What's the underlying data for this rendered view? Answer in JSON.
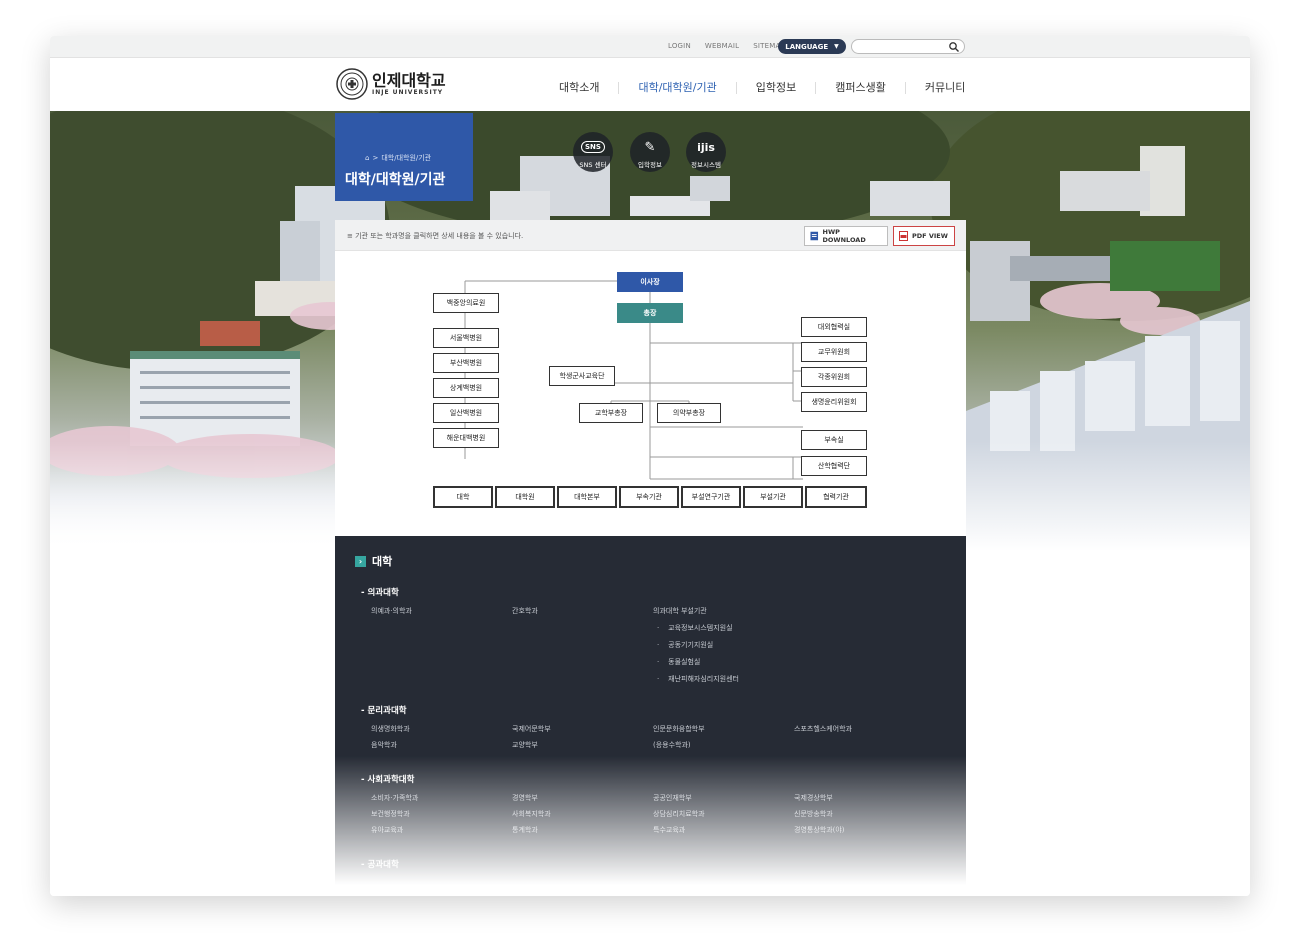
{
  "util": {
    "links": [
      "LOGIN",
      "WEBMAIL",
      "SITEMAP"
    ],
    "language_label": "LANGUAGE",
    "search_placeholder": ""
  },
  "header": {
    "logo_ko": "인제대학교",
    "logo_en": "INJE UNIVERSITY",
    "nav": [
      "대학소개",
      "대학/대학원/기관",
      "입학정보",
      "캠퍼스생활",
      "커뮤니티"
    ],
    "active_nav": "대학/대학원/기관"
  },
  "page": {
    "breadcrumb": "대학/대학원/기관",
    "title": "대학/대학원/기관"
  },
  "quick_links": [
    {
      "icon": "sns-icon",
      "glyph": "SNS",
      "label": "SNS 센터"
    },
    {
      "icon": "edit-icon",
      "glyph": "✎",
      "label": "입학정보"
    },
    {
      "icon": "ijis-icon",
      "glyph": "ijis",
      "label": "정보시스템"
    }
  ],
  "panel": {
    "note": "≡ 기관 또는 학과명을 클릭하면 상세 내용을 볼 수 있습니다.",
    "hwp_label": "HWP DOWNLOAD",
    "pdf_label": "PDF VIEW"
  },
  "org": {
    "chair": "이사장",
    "president": "총장",
    "hospitals": [
      "백중앙의료원",
      "서울백병원",
      "부산백병원",
      "상계백병원",
      "일산백병원",
      "해운대백병원"
    ],
    "rotc": "학생군사교육단",
    "vice_academic": "교학부총장",
    "vice_medical": "의약부총장",
    "right": [
      "대외협력실",
      "교무위원회",
      "각종위원회",
      "생명윤리위원회",
      "부속실",
      "산학협력단"
    ],
    "bottom": [
      "대학",
      "대학원",
      "대학본부",
      "부속기관",
      "부설연구기관",
      "부설기관",
      "협력기관"
    ]
  },
  "colleges": {
    "heading": "대학",
    "sections": [
      {
        "name": "- 의과대학",
        "cols": [
          [
            "의예과·의학과"
          ],
          [
            "간호학과"
          ],
          [
            "의과대학 부설기관"
          ],
          []
        ],
        "subitems": [
          "교육정보시스템지원실",
          "공동기기지원실",
          "동물실험실",
          "재난피해자심리지원센터"
        ]
      },
      {
        "name": "- 문리과대학",
        "cols": [
          [
            "의생명화학과",
            "음악학과"
          ],
          [
            "국제어문학부",
            "교양학부"
          ],
          [
            "인문문화융합학부",
            "(응용수학과)"
          ],
          [
            "스포츠헬스케어학과"
          ]
        ]
      },
      {
        "name": "- 사회과학대학",
        "cols": [
          [
            "소비자·가족학과",
            "보건행정학과",
            "유아교육과"
          ],
          [
            "경영학부",
            "사회복지학과",
            "통계학과"
          ],
          [
            "공공인재학부",
            "상담심리치료학과",
            "특수교육과"
          ],
          [
            "국제경상학부",
            "신문방송학과",
            "경영통상학과(야)"
          ]
        ]
      },
      {
        "name": "- 공과대학",
        "cols": [
          [],
          [],
          [],
          []
        ]
      }
    ]
  },
  "colors": {
    "primary_blue": "#2f58a8",
    "teal": "#3a8a88",
    "dark_panel": "#262b35",
    "nav_active": "#2f62b2"
  }
}
